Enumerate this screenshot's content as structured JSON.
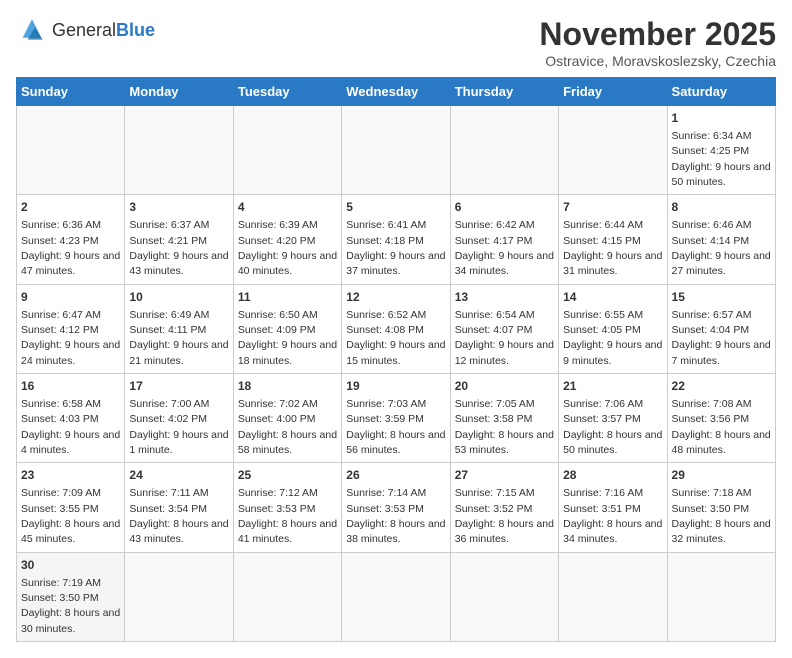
{
  "header": {
    "logo_general": "General",
    "logo_blue": "Blue",
    "month_title": "November 2025",
    "subtitle": "Ostravice, Moravskoslezsky, Czechia"
  },
  "days_of_week": [
    "Sunday",
    "Monday",
    "Tuesday",
    "Wednesday",
    "Thursday",
    "Friday",
    "Saturday"
  ],
  "weeks": [
    [
      {
        "day": "",
        "info": ""
      },
      {
        "day": "",
        "info": ""
      },
      {
        "day": "",
        "info": ""
      },
      {
        "day": "",
        "info": ""
      },
      {
        "day": "",
        "info": ""
      },
      {
        "day": "",
        "info": ""
      },
      {
        "day": "1",
        "info": "Sunrise: 6:34 AM\nSunset: 4:25 PM\nDaylight: 9 hours and 50 minutes."
      }
    ],
    [
      {
        "day": "2",
        "info": "Sunrise: 6:36 AM\nSunset: 4:23 PM\nDaylight: 9 hours and 47 minutes."
      },
      {
        "day": "3",
        "info": "Sunrise: 6:37 AM\nSunset: 4:21 PM\nDaylight: 9 hours and 43 minutes."
      },
      {
        "day": "4",
        "info": "Sunrise: 6:39 AM\nSunset: 4:20 PM\nDaylight: 9 hours and 40 minutes."
      },
      {
        "day": "5",
        "info": "Sunrise: 6:41 AM\nSunset: 4:18 PM\nDaylight: 9 hours and 37 minutes."
      },
      {
        "day": "6",
        "info": "Sunrise: 6:42 AM\nSunset: 4:17 PM\nDaylight: 9 hours and 34 minutes."
      },
      {
        "day": "7",
        "info": "Sunrise: 6:44 AM\nSunset: 4:15 PM\nDaylight: 9 hours and 31 minutes."
      },
      {
        "day": "8",
        "info": "Sunrise: 6:46 AM\nSunset: 4:14 PM\nDaylight: 9 hours and 27 minutes."
      }
    ],
    [
      {
        "day": "9",
        "info": "Sunrise: 6:47 AM\nSunset: 4:12 PM\nDaylight: 9 hours and 24 minutes."
      },
      {
        "day": "10",
        "info": "Sunrise: 6:49 AM\nSunset: 4:11 PM\nDaylight: 9 hours and 21 minutes."
      },
      {
        "day": "11",
        "info": "Sunrise: 6:50 AM\nSunset: 4:09 PM\nDaylight: 9 hours and 18 minutes."
      },
      {
        "day": "12",
        "info": "Sunrise: 6:52 AM\nSunset: 4:08 PM\nDaylight: 9 hours and 15 minutes."
      },
      {
        "day": "13",
        "info": "Sunrise: 6:54 AM\nSunset: 4:07 PM\nDaylight: 9 hours and 12 minutes."
      },
      {
        "day": "14",
        "info": "Sunrise: 6:55 AM\nSunset: 4:05 PM\nDaylight: 9 hours and 9 minutes."
      },
      {
        "day": "15",
        "info": "Sunrise: 6:57 AM\nSunset: 4:04 PM\nDaylight: 9 hours and 7 minutes."
      }
    ],
    [
      {
        "day": "16",
        "info": "Sunrise: 6:58 AM\nSunset: 4:03 PM\nDaylight: 9 hours and 4 minutes."
      },
      {
        "day": "17",
        "info": "Sunrise: 7:00 AM\nSunset: 4:02 PM\nDaylight: 9 hours and 1 minute."
      },
      {
        "day": "18",
        "info": "Sunrise: 7:02 AM\nSunset: 4:00 PM\nDaylight: 8 hours and 58 minutes."
      },
      {
        "day": "19",
        "info": "Sunrise: 7:03 AM\nSunset: 3:59 PM\nDaylight: 8 hours and 56 minutes."
      },
      {
        "day": "20",
        "info": "Sunrise: 7:05 AM\nSunset: 3:58 PM\nDaylight: 8 hours and 53 minutes."
      },
      {
        "day": "21",
        "info": "Sunrise: 7:06 AM\nSunset: 3:57 PM\nDaylight: 8 hours and 50 minutes."
      },
      {
        "day": "22",
        "info": "Sunrise: 7:08 AM\nSunset: 3:56 PM\nDaylight: 8 hours and 48 minutes."
      }
    ],
    [
      {
        "day": "23",
        "info": "Sunrise: 7:09 AM\nSunset: 3:55 PM\nDaylight: 8 hours and 45 minutes."
      },
      {
        "day": "24",
        "info": "Sunrise: 7:11 AM\nSunset: 3:54 PM\nDaylight: 8 hours and 43 minutes."
      },
      {
        "day": "25",
        "info": "Sunrise: 7:12 AM\nSunset: 3:53 PM\nDaylight: 8 hours and 41 minutes."
      },
      {
        "day": "26",
        "info": "Sunrise: 7:14 AM\nSunset: 3:53 PM\nDaylight: 8 hours and 38 minutes."
      },
      {
        "day": "27",
        "info": "Sunrise: 7:15 AM\nSunset: 3:52 PM\nDaylight: 8 hours and 36 minutes."
      },
      {
        "day": "28",
        "info": "Sunrise: 7:16 AM\nSunset: 3:51 PM\nDaylight: 8 hours and 34 minutes."
      },
      {
        "day": "29",
        "info": "Sunrise: 7:18 AM\nSunset: 3:50 PM\nDaylight: 8 hours and 32 minutes."
      }
    ],
    [
      {
        "day": "30",
        "info": "Sunrise: 7:19 AM\nSunset: 3:50 PM\nDaylight: 8 hours and 30 minutes."
      },
      {
        "day": "",
        "info": ""
      },
      {
        "day": "",
        "info": ""
      },
      {
        "day": "",
        "info": ""
      },
      {
        "day": "",
        "info": ""
      },
      {
        "day": "",
        "info": ""
      },
      {
        "day": "",
        "info": ""
      }
    ]
  ]
}
